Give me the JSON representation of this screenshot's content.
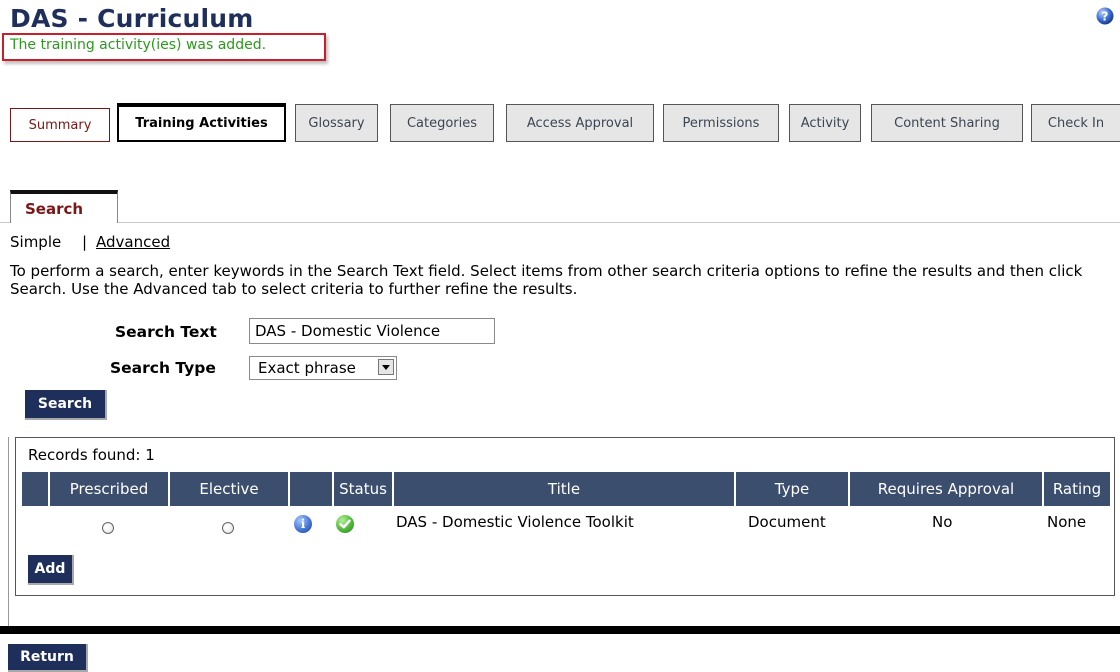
{
  "page": {
    "title": "DAS - Curriculum",
    "success_message": "The training activity(ies) was added."
  },
  "tabs": [
    {
      "label": "Summary"
    },
    {
      "label": "Training Activities"
    },
    {
      "label": "Glossary"
    },
    {
      "label": "Categories"
    },
    {
      "label": "Access Approval"
    },
    {
      "label": "Permissions"
    },
    {
      "label": "Activity"
    },
    {
      "label": "Content Sharing"
    },
    {
      "label": "Check In"
    }
  ],
  "search": {
    "tab_label": "Search",
    "mode_simple": "Simple",
    "mode_separator": "|",
    "mode_advanced": "Advanced",
    "instructions": "To perform a search, enter keywords in the Search Text field. Select items from other search criteria options to refine the results and then click Search. Use the Advanced tab to select criteria to further refine the results.",
    "text_label": "Search Text",
    "text_value": "DAS - Domestic Violence",
    "type_label": "Search Type",
    "type_value": "Exact phrase",
    "button_label": "Search"
  },
  "results": {
    "records_found": "Records found: 1",
    "columns": [
      "Prescribed",
      "Elective",
      "Status",
      "Title",
      "Type",
      "Requires Approval",
      "Rating"
    ],
    "rows": [
      {
        "title": "DAS - Domestic Violence Toolkit",
        "type": "Document",
        "requires_approval": "No",
        "rating": "None"
      }
    ],
    "add_label": "Add"
  },
  "footer": {
    "return_label": "Return"
  },
  "icons": {
    "help": "help-icon",
    "info": "info-icon",
    "status": "status-ok-icon"
  },
  "colors": {
    "title": "#1f2f5c",
    "success": "#2b9a1d",
    "highlight_border": "#c8202a",
    "header_bg": "#3b4e6e",
    "button_bg": "#1f2f5c"
  }
}
